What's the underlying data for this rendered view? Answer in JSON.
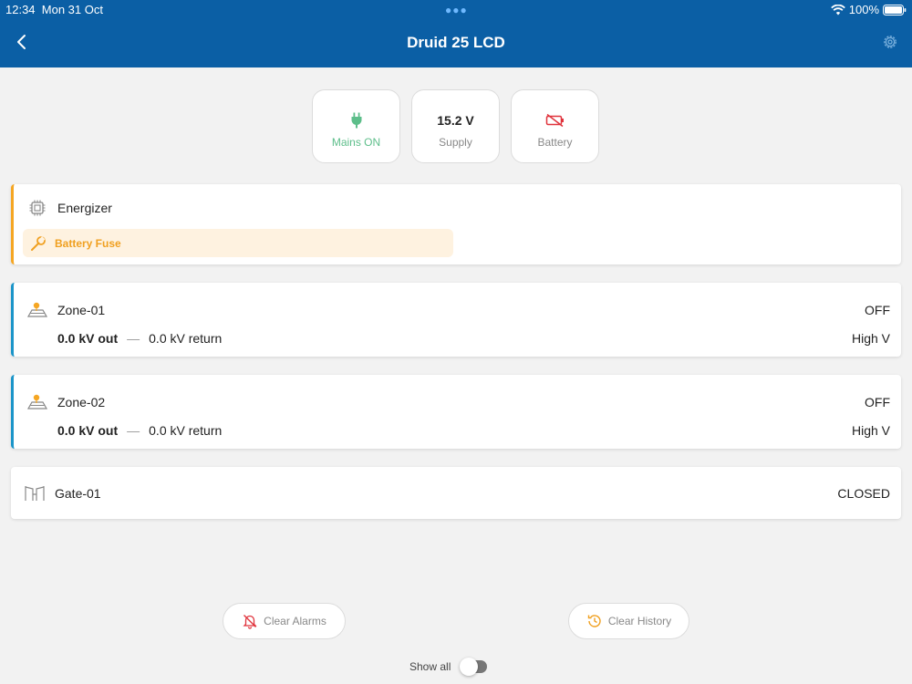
{
  "status_bar": {
    "time": "12:34",
    "date": "Mon 31 Oct",
    "battery": "100%"
  },
  "header": {
    "title": "Druid 25 LCD"
  },
  "tiles": [
    {
      "value": "",
      "label": "Mains ON",
      "icon": "plug-icon"
    },
    {
      "value": "15.2 V",
      "label": "Supply"
    },
    {
      "value": "",
      "label": "Battery",
      "icon": "battery-fault-icon"
    }
  ],
  "energizer": {
    "name": "Energizer",
    "alert": "Battery Fuse"
  },
  "zones": [
    {
      "name": "Zone-01",
      "status": "OFF",
      "out": "0.0 kV out",
      "ret": "0.0 kV return",
      "mode": "High V"
    },
    {
      "name": "Zone-02",
      "status": "OFF",
      "out": "0.0 kV out",
      "ret": "0.0 kV return",
      "mode": "High V"
    }
  ],
  "gate": {
    "name": "Gate-01",
    "status": "CLOSED"
  },
  "actions": {
    "clear_alarms": "Clear Alarms",
    "clear_history": "Clear History",
    "show_all": "Show all"
  },
  "colors": {
    "header": "#0b5fa5",
    "orange": "#f5a623",
    "blue": "#1b95c9",
    "green": "#5dbe8a",
    "red": "#e0333c"
  }
}
